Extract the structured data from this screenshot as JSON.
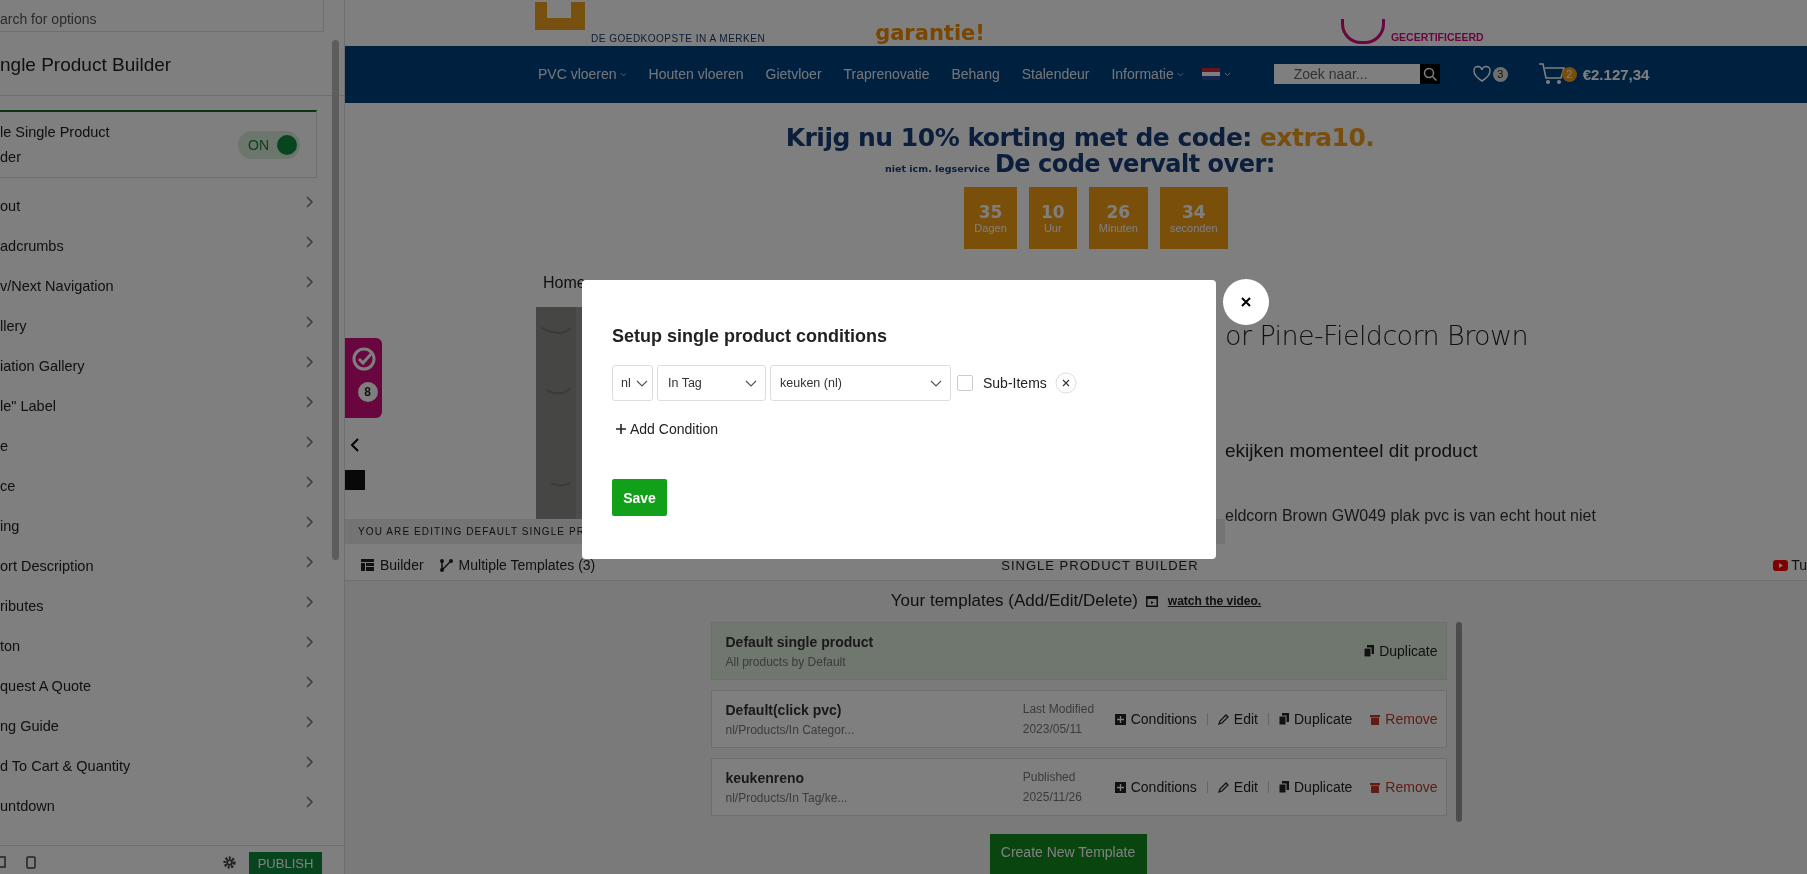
{
  "sidebar": {
    "search": {
      "placeholder": "arch for options"
    },
    "title": "ngle Product Builder",
    "toggle": {
      "label": "le Single Product",
      "label_2": "der",
      "on": true,
      "state_text": "ON"
    },
    "items": [
      "out",
      "adcrumbs",
      "v/Next Navigation",
      "llery",
      "iation Gallery",
      "le\" Label",
      "e",
      "ce",
      "ing",
      "ort Description",
      "ributes",
      "ton",
      "quest A Quote",
      "ng Guide",
      "d To Cart & Quantity",
      "untdown"
    ],
    "publish": "PUBLISH"
  },
  "header": {
    "logo_tagline": "DE GOEDKOOPSTE IN A MERKEN",
    "slogan": "garantie!",
    "badge_text": "GECERTIFICEERD"
  },
  "nav": {
    "items": [
      {
        "label": "PVC vloeren",
        "dropdown": true
      },
      {
        "label": "Houten vloeren",
        "dropdown": false
      },
      {
        "label": "Gietvloer",
        "dropdown": false
      },
      {
        "label": "Traprenovatie",
        "dropdown": false
      },
      {
        "label": "Behang",
        "dropdown": false
      },
      {
        "label": "Stalendeur",
        "dropdown": false
      },
      {
        "label": "Informatie",
        "dropdown": true
      }
    ],
    "search": {
      "placeholder": "Zoek naar..."
    },
    "wishlist_count": "3",
    "cart_count": "2",
    "cart_total": "€2.127,34"
  },
  "promo": {
    "headline": "Krijg nu 10% korting met de code:",
    "code": "extra10.",
    "note": "niet icm.  legservice",
    "subheadline": "De code vervalt over:",
    "countdown": [
      {
        "value": "35",
        "unit": "Dagen"
      },
      {
        "value": "10",
        "unit": "Uur"
      },
      {
        "value": "26",
        "unit": "Minuten"
      },
      {
        "value": "34",
        "unit": "seconden"
      }
    ]
  },
  "product": {
    "breadcrumb": "Home",
    "title": "or Pine-Fieldcorn Brown",
    "viewers": "ekijken momenteel dit product",
    "description": "eldcorn Brown GW049 plak pvc is van echt hout niet",
    "widget_count": "8"
  },
  "editing_bar": "YOU ARE EDITING DEFAULT SINGLE PR",
  "builder": {
    "tabs": [
      {
        "label": "Builder",
        "kind": "builder"
      },
      {
        "label": "Multiple Templates (3)",
        "kind": "templates"
      }
    ],
    "title": "SINGLE PRODUCT BUILDER",
    "help": "Tu"
  },
  "templates": {
    "heading": "Your templates (Add/Edit/Delete)",
    "video_link": "watch the video.",
    "rows": [
      {
        "name": "Default single product",
        "subtitle": "All products by Default",
        "active": true,
        "actions": [
          {
            "label": "Duplicate",
            "kind": "duplicate"
          }
        ]
      },
      {
        "name": "Default(click pvc)",
        "subtitle": "nl/Products/In Categor...",
        "active": false,
        "status": "Last Modified",
        "date": "2023/05/11",
        "actions": [
          {
            "label": "Conditions",
            "kind": "conditions"
          },
          {
            "label": "Edit",
            "kind": "edit"
          },
          {
            "label": "Duplicate",
            "kind": "duplicate"
          },
          {
            "label": "Remove",
            "kind": "remove"
          }
        ]
      },
      {
        "name": "keukenreno",
        "subtitle": "nl/Products/In Tag/ke...",
        "active": false,
        "status": "Published",
        "date": "2025/11/26",
        "actions": [
          {
            "label": "Conditions",
            "kind": "conditions"
          },
          {
            "label": "Edit",
            "kind": "edit"
          },
          {
            "label": "Duplicate",
            "kind": "duplicate"
          },
          {
            "label": "Remove",
            "kind": "remove"
          }
        ]
      }
    ],
    "create_button": "Create New Template"
  },
  "modal": {
    "title": "Setup single product conditions",
    "conditions": [
      {
        "language": "nl",
        "type": "In Tag",
        "value": "keuken (nl)",
        "sub_items_label": "Sub-Items",
        "sub_items": false
      }
    ],
    "add_condition": "Add Condition",
    "save": "Save"
  }
}
